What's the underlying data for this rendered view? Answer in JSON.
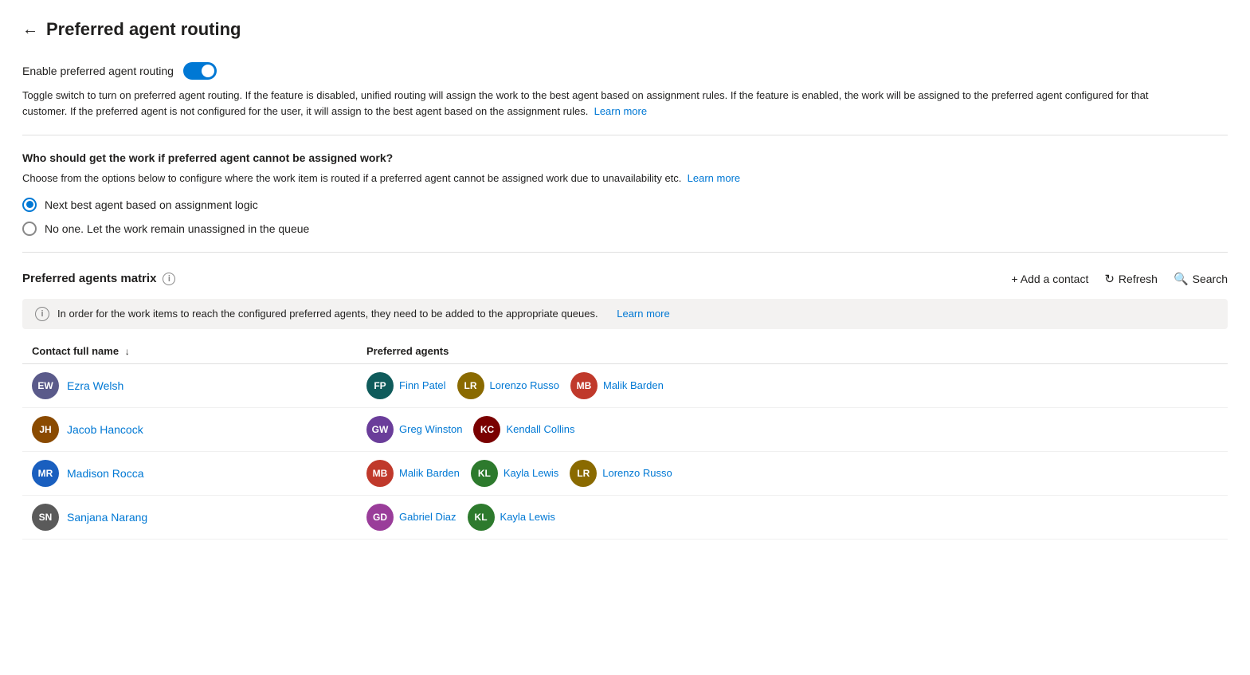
{
  "page": {
    "title": "Preferred agent routing",
    "back_label": "←"
  },
  "toggle_section": {
    "label": "Enable preferred agent routing",
    "enabled": true,
    "description": "Toggle switch to turn on preferred agent routing. If the feature is disabled, unified routing will assign the work to the best agent based on assignment rules. If the feature is enabled, the work will be assigned to the preferred agent configured for that customer. If the preferred agent is not configured for the user, it will assign to the best agent based on the assignment rules.",
    "learn_more": "Learn more"
  },
  "routing_section": {
    "title": "Who should get the work if preferred agent cannot be assigned work?",
    "description": "Choose from the options below to configure where the work item is routed if a preferred agent cannot be assigned work due to unavailability etc.",
    "learn_more": "Learn more",
    "options": [
      {
        "label": "Next best agent based on assignment logic",
        "selected": true
      },
      {
        "label": "No one. Let the work remain unassigned in the queue",
        "selected": false
      }
    ]
  },
  "matrix_section": {
    "title": "Preferred agents matrix",
    "info_tooltip": "i",
    "add_contact_label": "+ Add a contact",
    "refresh_label": "Refresh",
    "search_label": "Search",
    "notice_text": "In order for the work items to reach the configured preferred agents, they need to be added to the appropriate queues.",
    "notice_learn_more": "Learn more",
    "table": {
      "col_contact": "Contact full name",
      "col_sort_arrow": "↓",
      "col_agents": "Preferred agents",
      "rows": [
        {
          "contact_initials": "EW",
          "contact_color": "#5a5a8a",
          "contact_name": "Ezra Welsh",
          "agents": [
            {
              "initials": "FP",
              "color": "#0f5b5b",
              "name": "Finn Patel"
            },
            {
              "initials": "LR",
              "color": "#8a6a00",
              "name": "Lorenzo Russo"
            },
            {
              "initials": "MB",
              "color": "#c0392b",
              "name": "Malik Barden"
            }
          ]
        },
        {
          "contact_initials": "JH",
          "contact_color": "#8a4a00",
          "contact_name": "Jacob Hancock",
          "agents": [
            {
              "initials": "GW",
              "color": "#6a3d9a",
              "name": "Greg Winston"
            },
            {
              "initials": "KC",
              "color": "#7a0000",
              "name": "Kendall Collins"
            }
          ]
        },
        {
          "contact_initials": "MR",
          "contact_color": "#1a5fbf",
          "contact_name": "Madison Rocca",
          "agents": [
            {
              "initials": "MB",
              "color": "#c0392b",
              "name": "Malik Barden"
            },
            {
              "initials": "KL",
              "color": "#2d7a2d",
              "name": "Kayla Lewis"
            },
            {
              "initials": "LR",
              "color": "#8a6a00",
              "name": "Lorenzo Russo"
            }
          ]
        },
        {
          "contact_initials": "SN",
          "contact_color": "#5a5a5a",
          "contact_name": "Sanjana Narang",
          "agents": [
            {
              "initials": "GD",
              "color": "#9a3d9a",
              "name": "Gabriel Diaz"
            },
            {
              "initials": "KL",
              "color": "#2d7a2d",
              "name": "Kayla Lewis"
            }
          ]
        }
      ]
    }
  }
}
